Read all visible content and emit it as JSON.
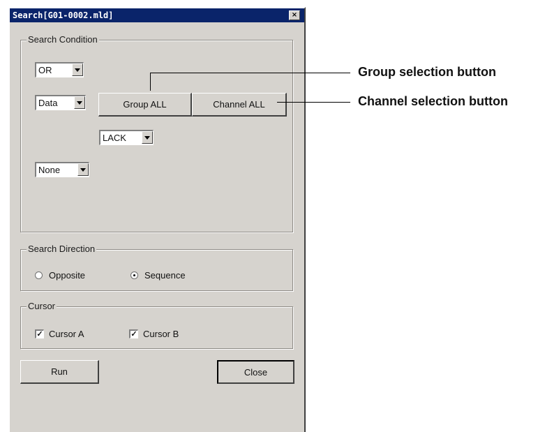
{
  "window": {
    "title": "Search[G01-0002.mld]",
    "close_glyph": "×"
  },
  "search_condition": {
    "legend": "Search Condition",
    "logic_select": "OR",
    "type_select": "Data",
    "group_all_label": "Group ALL",
    "channel_all_label": "Channel ALL",
    "alarm_select": "LACK",
    "extra_select": "None"
  },
  "search_direction": {
    "legend": "Search Direction",
    "options": [
      {
        "label": "Opposite",
        "selected": false
      },
      {
        "label": "Sequence",
        "selected": true
      }
    ]
  },
  "cursor": {
    "legend": "Cursor",
    "cursor_a": {
      "label": "Cursor A",
      "checked": true
    },
    "cursor_b": {
      "label": "Cursor B",
      "checked": true
    },
    "check_glyph": "✓"
  },
  "actions": {
    "run_label": "Run",
    "close_label": "Close"
  },
  "annotations": {
    "group_button": "Group selection button",
    "channel_button": "Channel selection button"
  }
}
